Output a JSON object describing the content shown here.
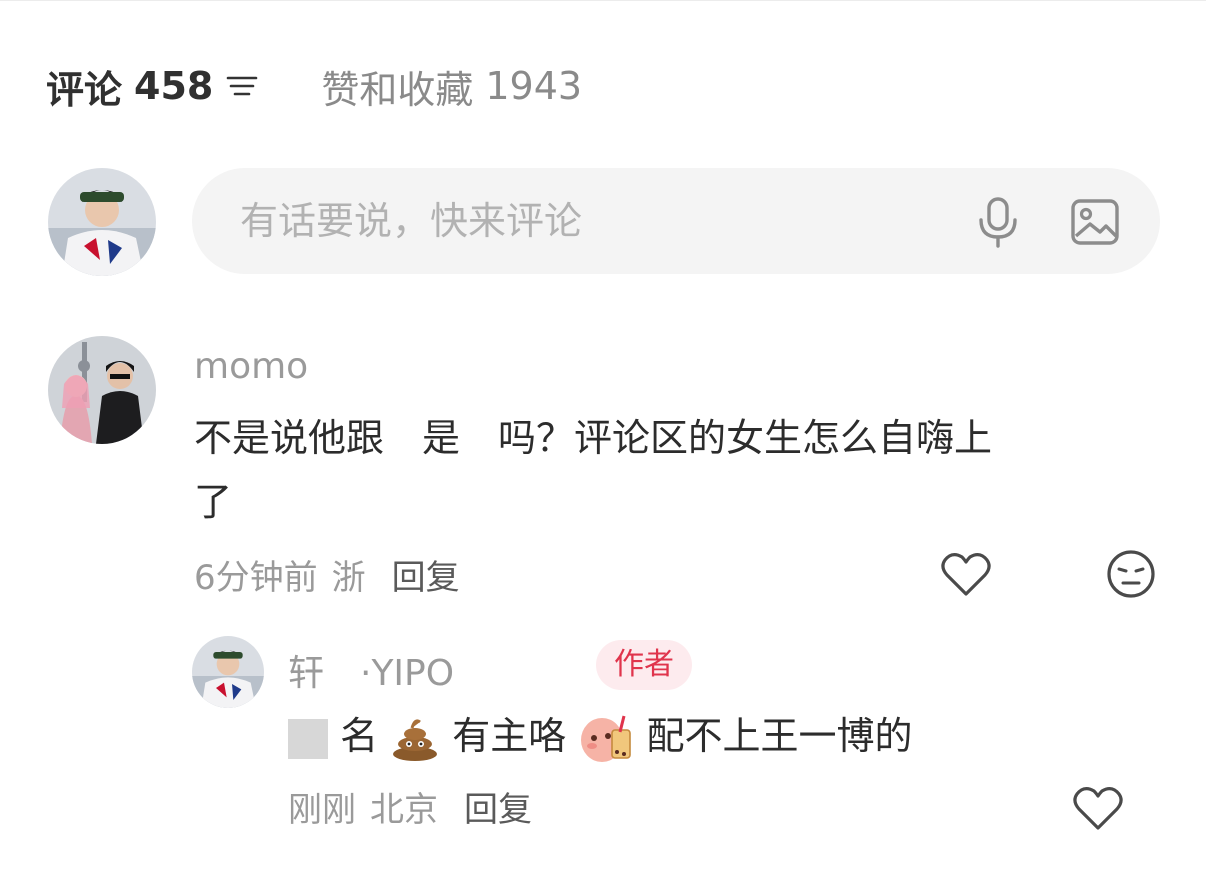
{
  "tabs": {
    "comments_label": "评论",
    "comments_count": "458",
    "likes_label": "赞和收藏",
    "likes_count": "1943"
  },
  "comment_input": {
    "placeholder": "有话要说，快来评论"
  },
  "comments": [
    {
      "username": "momo",
      "text_line1": "不是说他跟　是　吗？评论区的女生怎么自嗨上",
      "text_line2": "了",
      "time": "6分钟前",
      "location": "浙",
      "reply_label": "回复"
    }
  ],
  "reply": {
    "username": "轩　·YIPO",
    "badge": "作者",
    "text_a": "名",
    "text_b": "有主咯",
    "text_c": "配不上王一博的",
    "time": "刚刚",
    "location": "北京",
    "reply_label": "回复"
  },
  "colors": {
    "accent": "#e0344c",
    "badge_bg": "#fdebee",
    "muted": "#9a9a9a",
    "input_bg": "#f4f4f4"
  },
  "icons": {
    "sort": "sort-lines-icon",
    "mic": "microphone-icon",
    "image": "image-icon",
    "like": "heart-icon",
    "dislike": "unhappy-face-icon"
  }
}
